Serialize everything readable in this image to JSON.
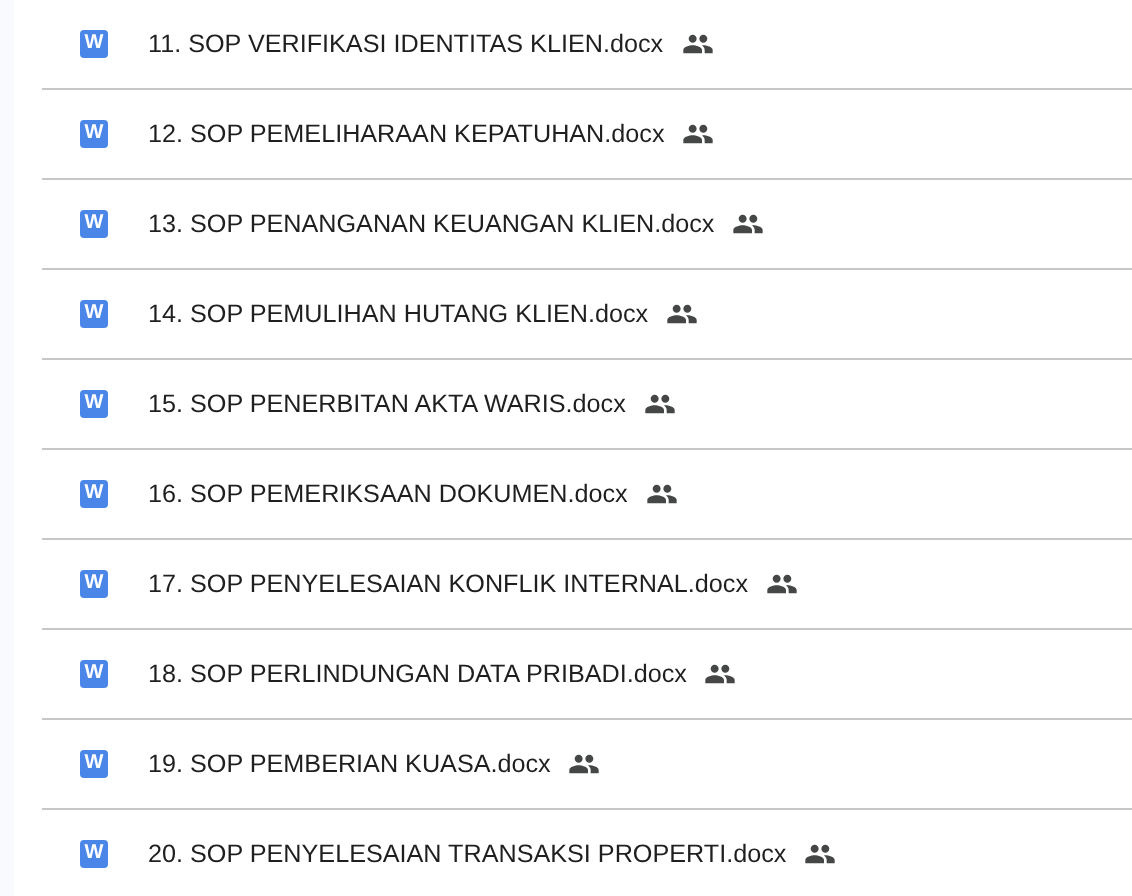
{
  "files": [
    {
      "icon": "W",
      "name": "11. SOP VERIFIKASI IDENTITAS KLIEN.docx",
      "shared": true
    },
    {
      "icon": "W",
      "name": "12. SOP PEMELIHARAAN KEPATUHAN.docx",
      "shared": true
    },
    {
      "icon": "W",
      "name": "13. SOP PENANGANAN KEUANGAN KLIEN.docx",
      "shared": true
    },
    {
      "icon": "W",
      "name": "14. SOP PEMULIHAN HUTANG KLIEN.docx",
      "shared": true
    },
    {
      "icon": "W",
      "name": "15. SOP PENERBITAN AKTA WARIS.docx",
      "shared": true
    },
    {
      "icon": "W",
      "name": "16. SOP PEMERIKSAAN DOKUMEN.docx",
      "shared": true
    },
    {
      "icon": "W",
      "name": "17. SOP PENYELESAIAN KONFLIK INTERNAL.docx",
      "shared": true
    },
    {
      "icon": "W",
      "name": "18. SOP PERLINDUNGAN DATA PRIBADI.docx",
      "shared": true
    },
    {
      "icon": "W",
      "name": "19. SOP PEMBERIAN KUASA.docx",
      "shared": true
    },
    {
      "icon": "W",
      "name": "20. SOP PENYELESAIAN TRANSAKSI PROPERTI.docx",
      "shared": true
    }
  ]
}
